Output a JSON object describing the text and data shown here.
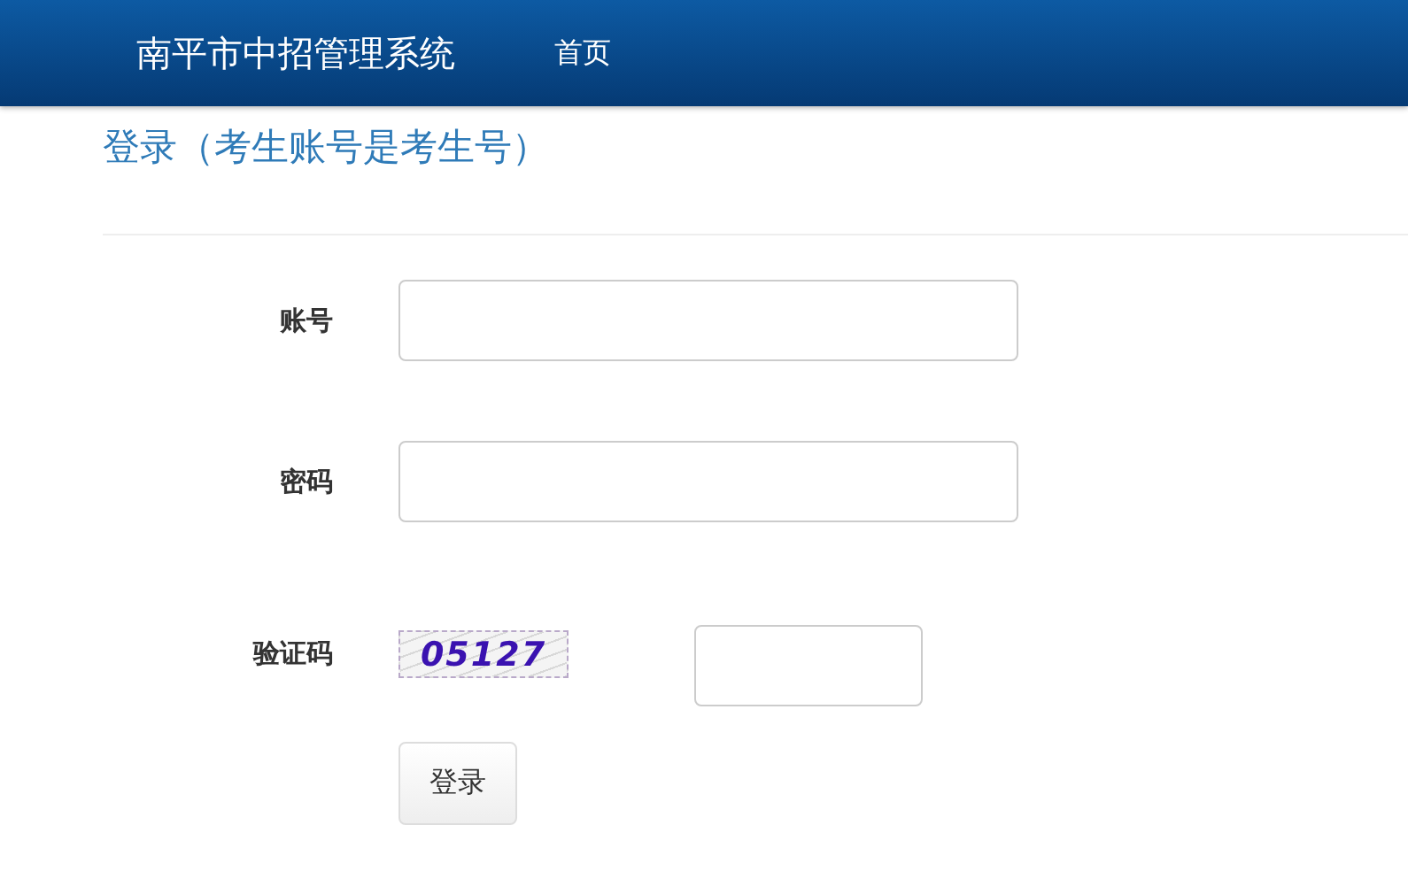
{
  "navbar": {
    "brand": "南平市中招管理系统",
    "links": [
      {
        "label": "首页"
      }
    ]
  },
  "heading": "登录（考生账号是考生号）",
  "form": {
    "fields": [
      {
        "label": "账号",
        "kind": "text"
      },
      {
        "label": "密码",
        "kind": "password"
      },
      {
        "label": "验证码",
        "kind": "captcha",
        "captcha": "05127"
      }
    ],
    "submit": "登录"
  }
}
